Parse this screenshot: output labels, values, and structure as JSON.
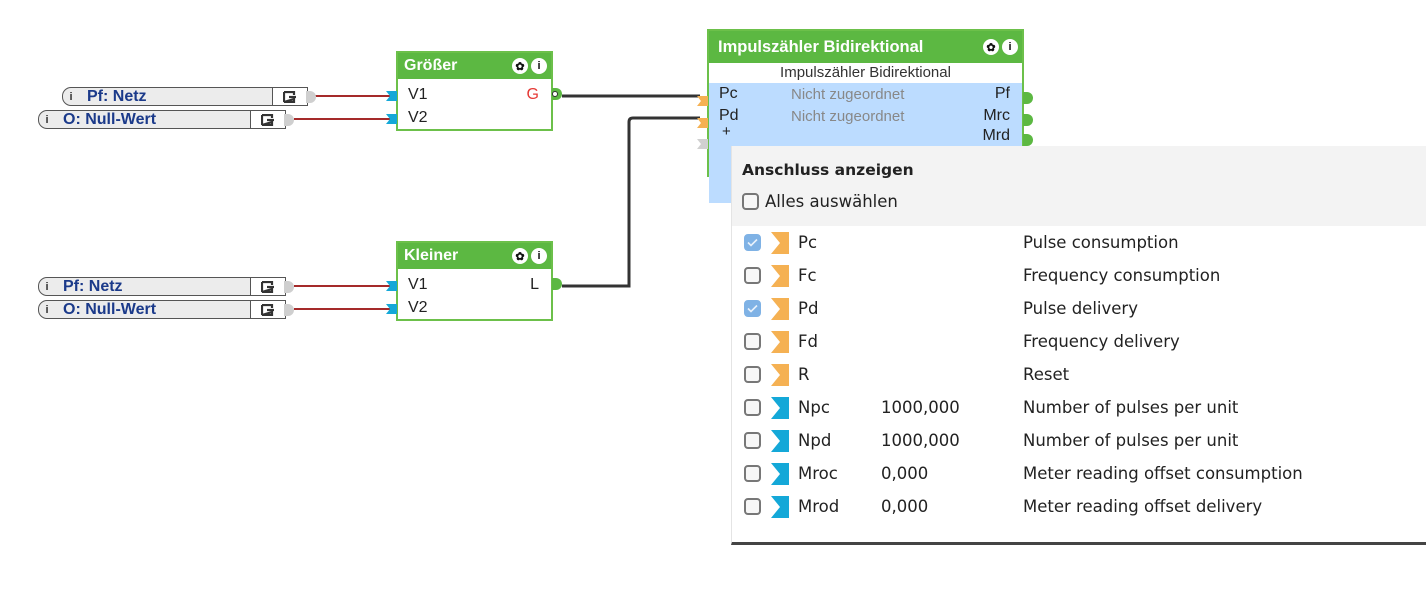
{
  "inputs": [
    {
      "label": "Pf: Netz",
      "info_icon": "info-icon",
      "output_icon": "output-arrow-icon"
    },
    {
      "label": "O: Null-Wert",
      "info_icon": "info-icon",
      "output_icon": "output-arrow-icon"
    },
    {
      "label": "Pf: Netz",
      "info_icon": "info-icon",
      "output_icon": "output-arrow-icon"
    },
    {
      "label": "O: Null-Wert",
      "info_icon": "info-icon",
      "output_icon": "output-arrow-icon"
    }
  ],
  "blocks": {
    "groesser": {
      "title": "Größer",
      "inputs": [
        "V1",
        "V2"
      ],
      "output": "G",
      "output_color": "#e53935",
      "icons": [
        "gear-icon",
        "info-icon"
      ]
    },
    "kleiner": {
      "title": "Kleiner",
      "inputs": [
        "V1",
        "V2"
      ],
      "output": "L",
      "icons": [
        "gear-icon",
        "info-icon"
      ]
    },
    "impuls": {
      "title": "Impulszähler Bidirektional",
      "subtitle": "Impulszähler Bidirektional",
      "inputs": [
        {
          "name": "Pc",
          "status": "Nicht zugeordnet"
        },
        {
          "name": "Pd",
          "status": "Nicht zugeordnet"
        }
      ],
      "add_input": "+",
      "outputs": [
        "Pf",
        "Mrc",
        "Mrd"
      ],
      "icons": [
        "gear-icon",
        "info-icon"
      ]
    }
  },
  "popup": {
    "title": "Anschluss anzeigen",
    "select_all": {
      "label": "Alles auswählen",
      "checked": false
    },
    "items": [
      {
        "name": "Pc",
        "value": "",
        "description": "Pulse consumption",
        "checked": true,
        "type": "orange"
      },
      {
        "name": "Fc",
        "value": "",
        "description": "Frequency consumption",
        "checked": false,
        "type": "orange"
      },
      {
        "name": "Pd",
        "value": "",
        "description": "Pulse delivery",
        "checked": true,
        "type": "orange"
      },
      {
        "name": "Fd",
        "value": "",
        "description": "Frequency delivery",
        "checked": false,
        "type": "orange"
      },
      {
        "name": "R",
        "value": "",
        "description": "Reset",
        "checked": false,
        "type": "orange"
      },
      {
        "name": "Npc",
        "value": "1000,000",
        "description": "Number of pulses per unit",
        "checked": false,
        "type": "blue"
      },
      {
        "name": "Npd",
        "value": "1000,000",
        "description": "Number of pulses per unit",
        "checked": false,
        "type": "blue"
      },
      {
        "name": "Mroc",
        "value": "0,000",
        "description": "Meter reading offset consumption",
        "checked": false,
        "type": "blue"
      },
      {
        "name": "Mrod",
        "value": "0,000",
        "description": "Meter reading offset delivery",
        "checked": false,
        "type": "blue"
      }
    ]
  },
  "colors": {
    "block_green": "#5cb842",
    "wire_red": "#a52a2a",
    "wire_dark": "#333333",
    "port_orange": "#f5b153",
    "port_blue": "#14a8d8",
    "checkbox_checked": "#7fb2e5",
    "body_blue": "#bcdcff"
  }
}
